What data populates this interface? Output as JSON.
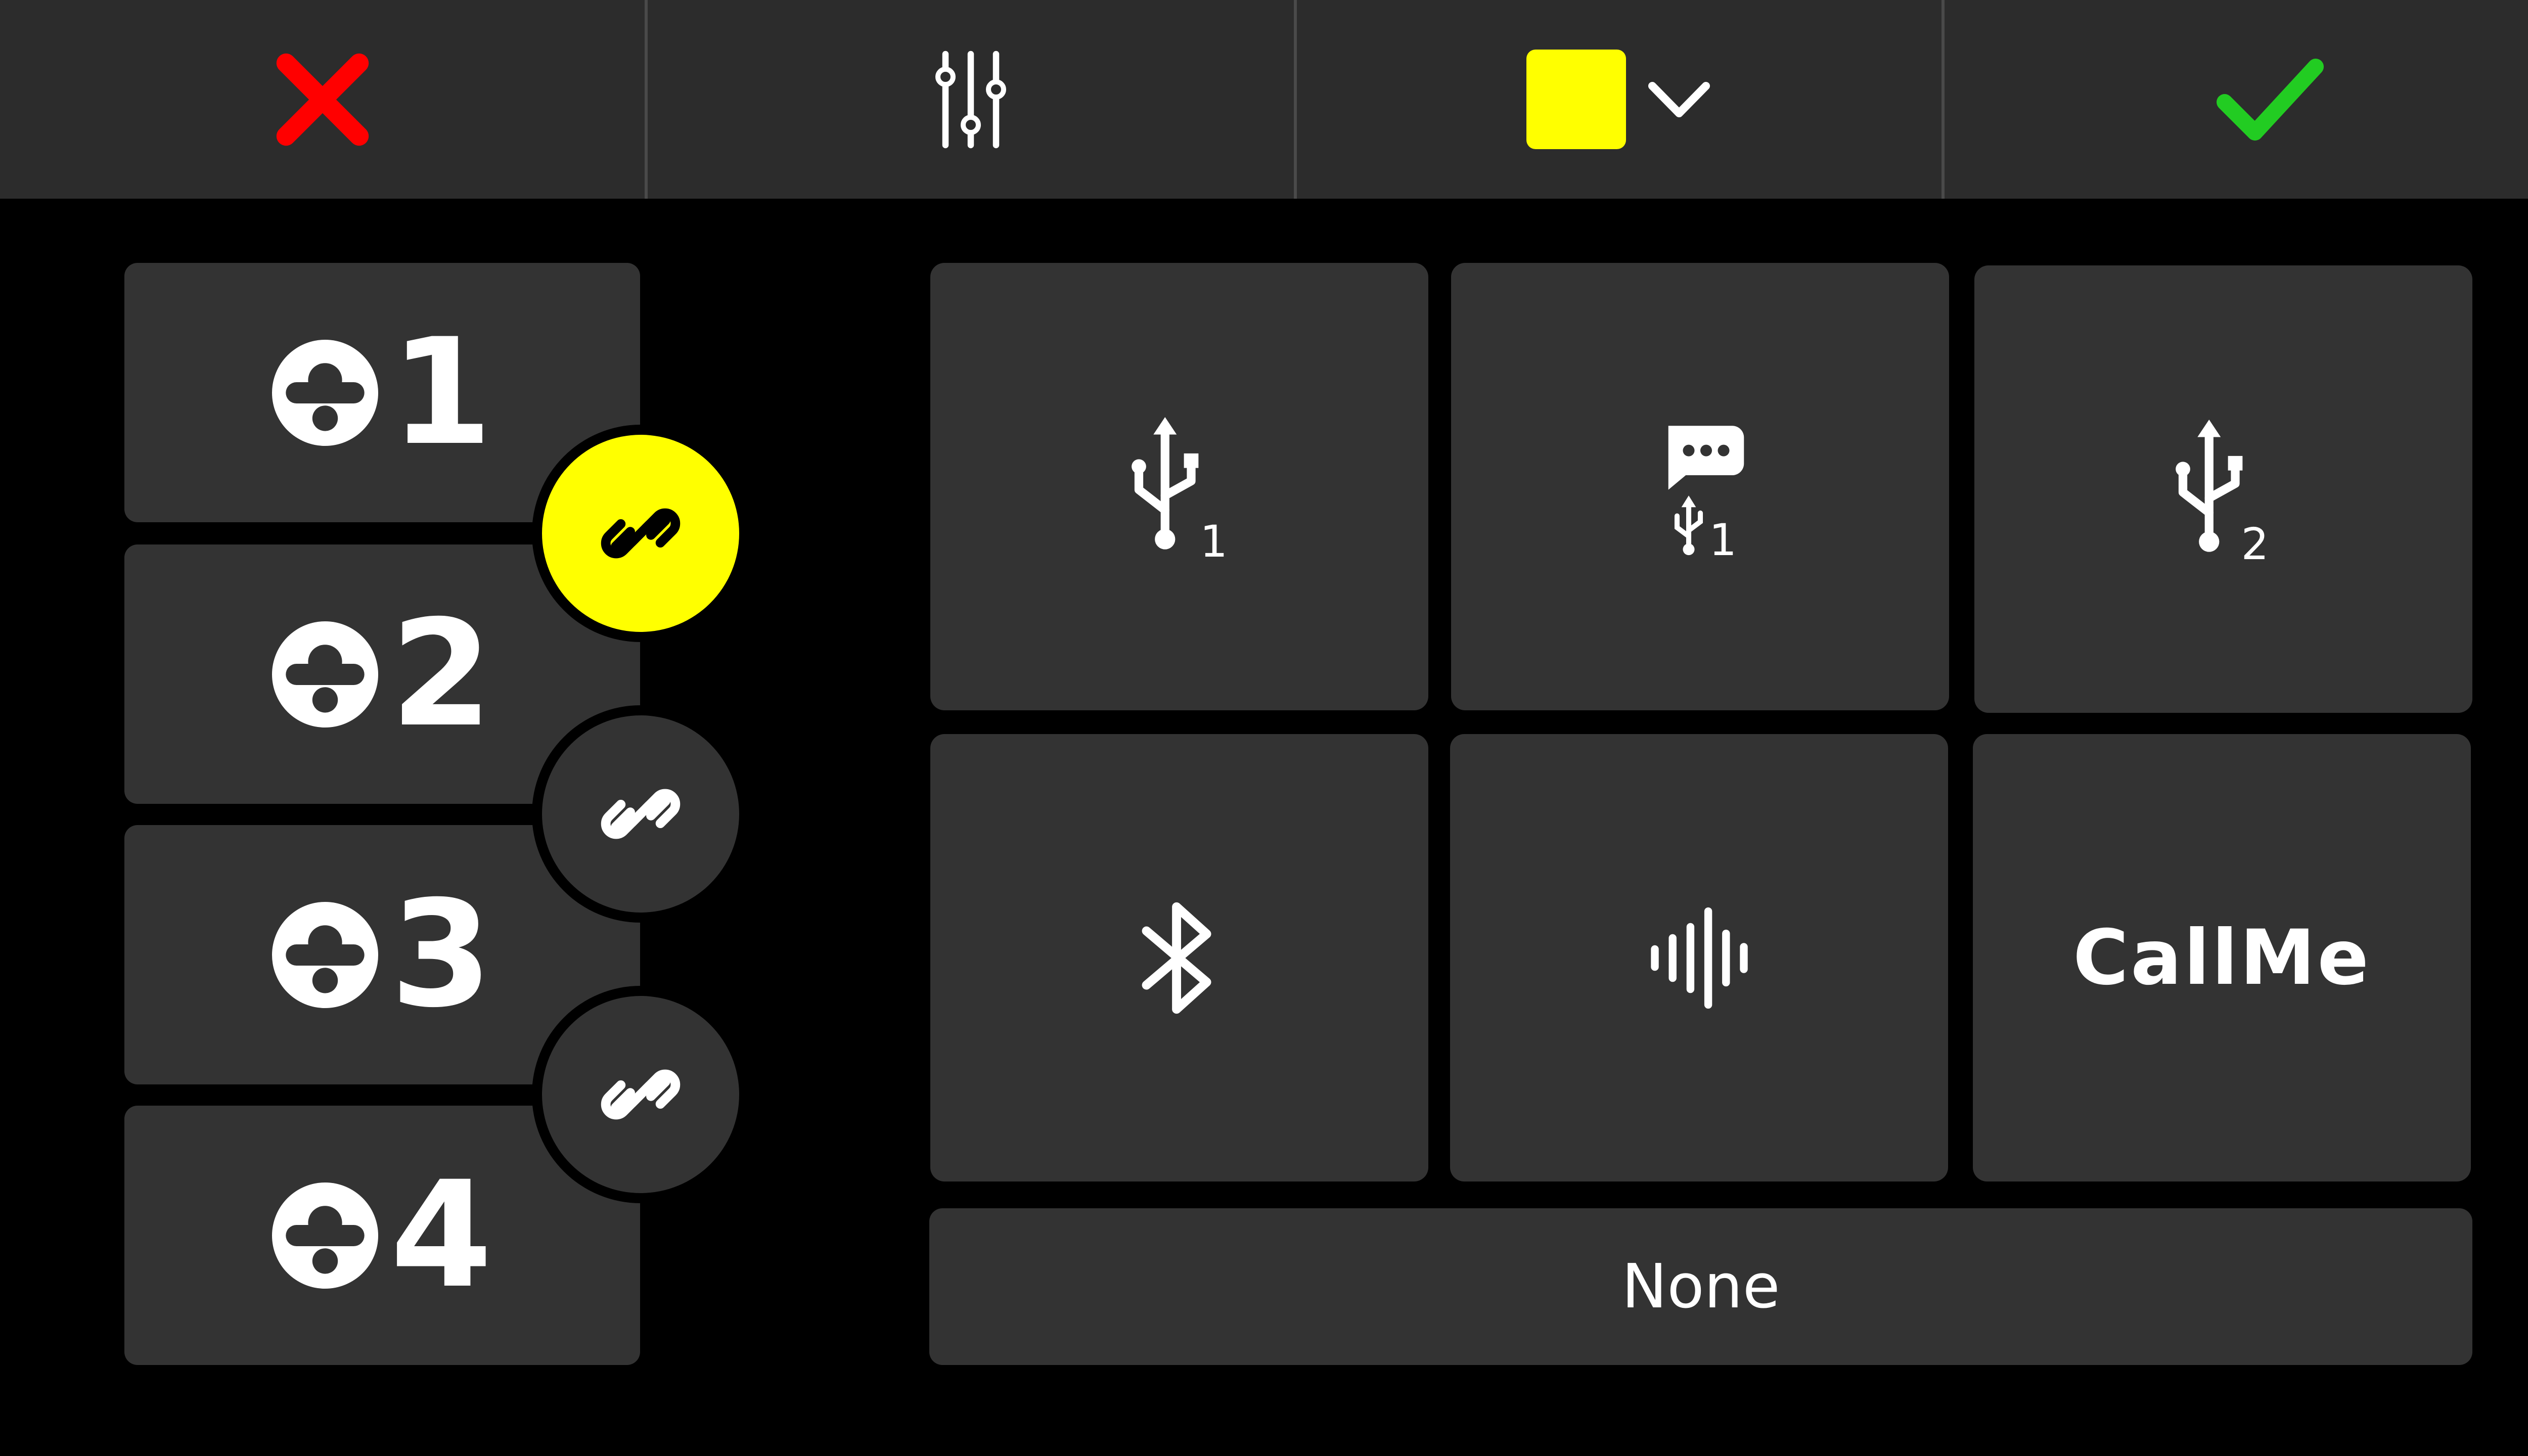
{
  "toolbar": {
    "cancel_icon": "close-x-icon",
    "cancel_color": "#ff0000",
    "mixer_icon": "sliders-icon",
    "color_swatch": "#ffff00",
    "color_dropdown_icon": "chevron-down-icon",
    "confirm_icon": "checkmark-icon",
    "confirm_color": "#22cc22"
  },
  "inputs": [
    {
      "number": "1",
      "icon": "microphone-input-icon"
    },
    {
      "number": "2",
      "icon": "microphone-input-icon"
    },
    {
      "number": "3",
      "icon": "microphone-input-icon"
    },
    {
      "number": "4",
      "icon": "microphone-input-icon"
    }
  ],
  "links": [
    {
      "between": "1-2",
      "active": true,
      "active_color": "#ffff00"
    },
    {
      "between": "2-3",
      "active": false
    },
    {
      "between": "3-4",
      "active": false
    }
  ],
  "sources": [
    {
      "icon": "usb-icon",
      "subscript": "1"
    },
    {
      "icon": "chat-usb-icon",
      "subscript": "1"
    },
    {
      "icon": "usb-icon",
      "subscript": "2"
    },
    {
      "icon": "bluetooth-icon"
    },
    {
      "icon": "audio-waveform-icon"
    },
    {
      "icon": "callme-icon",
      "label": "CallMe"
    }
  ],
  "none_button": {
    "label": "None"
  }
}
